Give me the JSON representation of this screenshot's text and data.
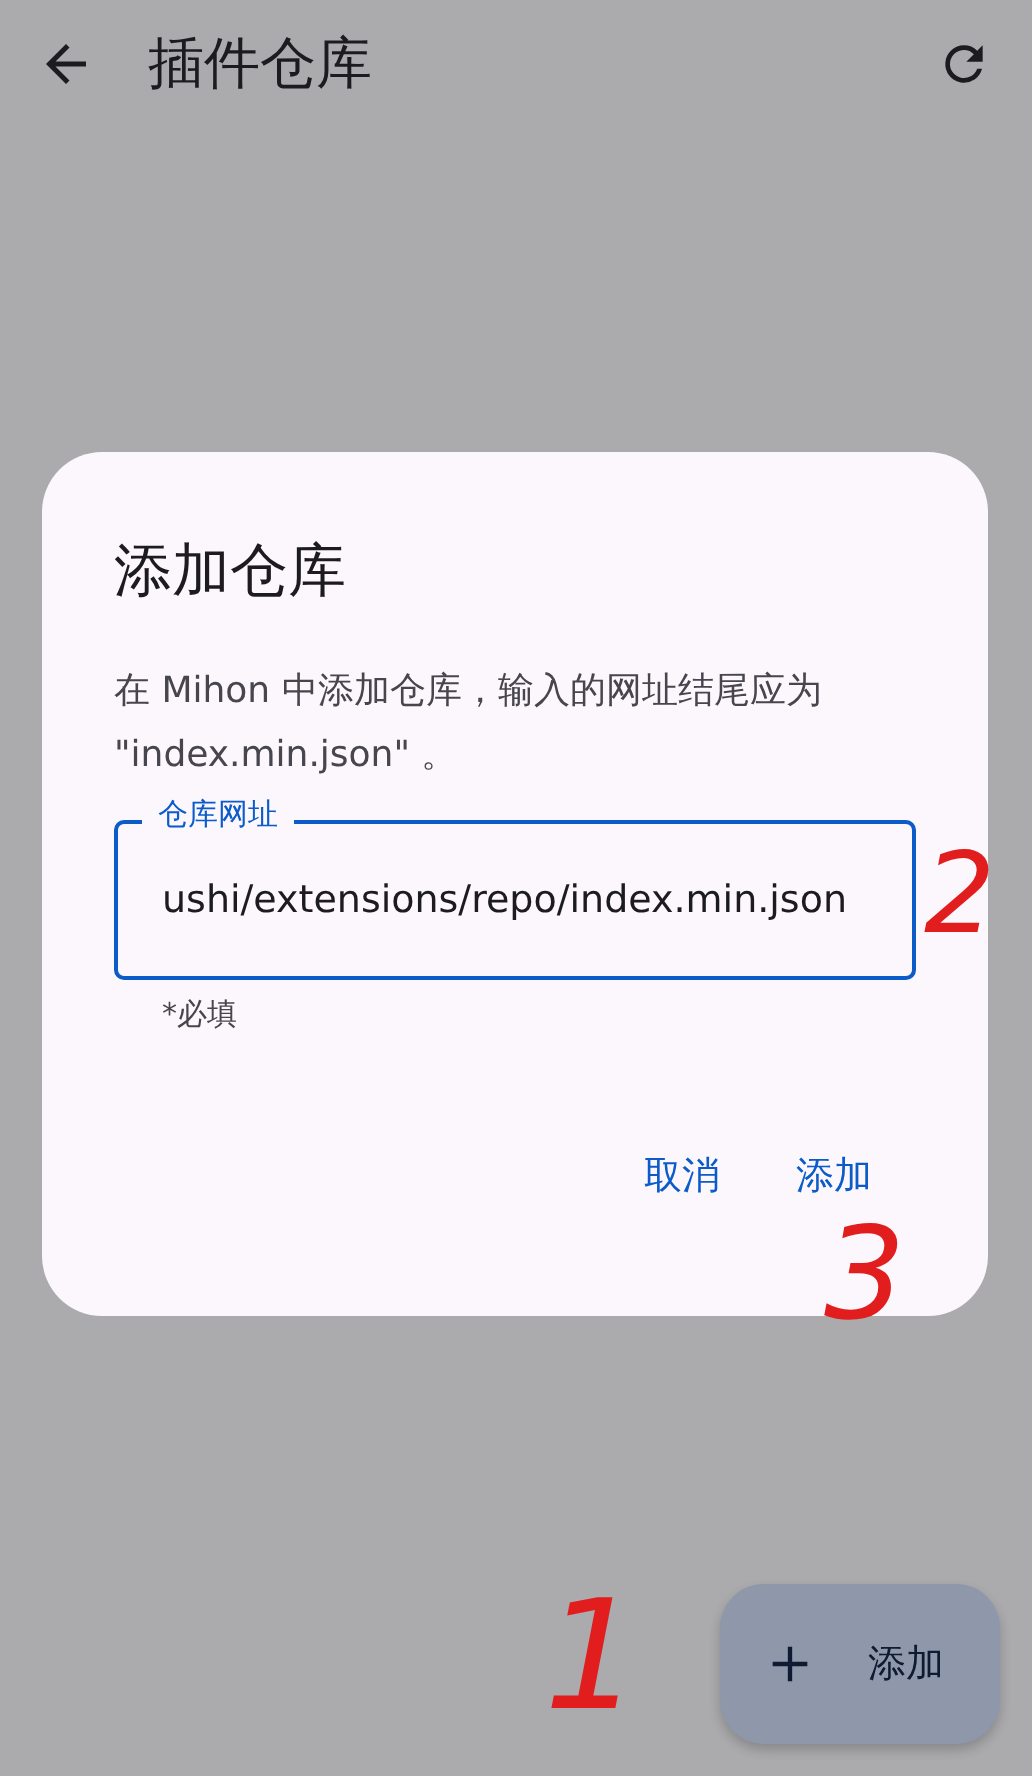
{
  "app_bar": {
    "title": "插件仓库"
  },
  "dialog": {
    "title": "添加仓库",
    "message": "在 Mihon 中添加仓库，输入的网址结尾应为 \"index.min.json\" 。",
    "field": {
      "label": "仓库网址",
      "value": "ushi/extensions/repo/index.min.json",
      "helper": "*必填"
    },
    "buttons": [
      "取消",
      "添加"
    ]
  },
  "fab": {
    "label": "添加"
  },
  "annotations": [
    {
      "text": "2",
      "color": "#e11d1d"
    },
    {
      "text": "3",
      "color": "#e11d1d"
    },
    {
      "text": "1",
      "color": "#e11d1d"
    }
  ]
}
